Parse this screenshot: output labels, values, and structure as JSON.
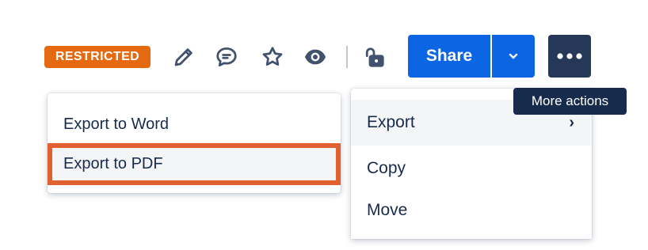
{
  "toolbar": {
    "restricted_badge": "RESTRICTED",
    "icons": [
      "edit-pencil-icon",
      "comment-icon",
      "star-icon",
      "watch-eye-icon",
      "unlocked-padlock-icon"
    ],
    "share_label": "Share",
    "share_dropdown_icon": "chevron-down-icon",
    "more_icon": "ellipsis-icon"
  },
  "tooltip": {
    "text": "More actions"
  },
  "export_submenu": {
    "items": [
      {
        "label": "Export to Word"
      },
      {
        "label": "Export to PDF",
        "highlighted": true
      }
    ]
  },
  "more_menu": {
    "items": [
      {
        "label": "Export",
        "has_submenu": true
      },
      {
        "label": "Copy"
      },
      {
        "label": "Move"
      }
    ],
    "submenu_chevron": "›"
  },
  "colors": {
    "restricted": "#e56910",
    "primary": "#0c66e4",
    "more_button": "#253858",
    "tooltip_bg": "#172b4d",
    "highlight_border": "#e06030",
    "text": "#172b4d",
    "icon": "#42526e"
  }
}
